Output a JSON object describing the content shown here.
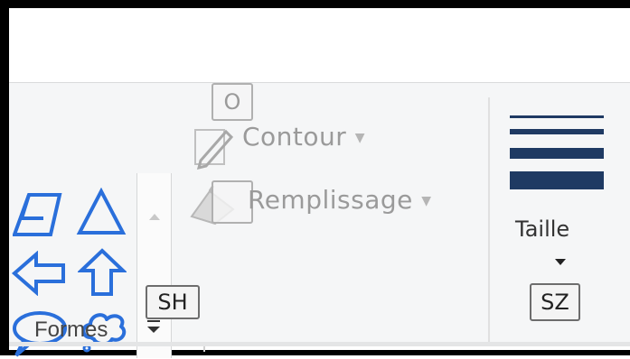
{
  "ribbon": {
    "shapes_group": {
      "label": "Formes",
      "keytip": "SH",
      "shapes": [
        "parallelogram-icon",
        "triangle-icon",
        "left-arrow-icon",
        "up-arrow-icon",
        "callout-oval-icon",
        "callout-cloud-icon"
      ]
    },
    "outline": {
      "label": "Contour",
      "keytip": "O"
    },
    "fill": {
      "label": "Remplissage",
      "keytip": ""
    },
    "size": {
      "label": "Taille",
      "keytip": "SZ"
    }
  },
  "colors": {
    "shape_stroke": "#2a6fdb",
    "line_icon": "#1f3a63",
    "disabled_text": "#9a9a9a"
  }
}
